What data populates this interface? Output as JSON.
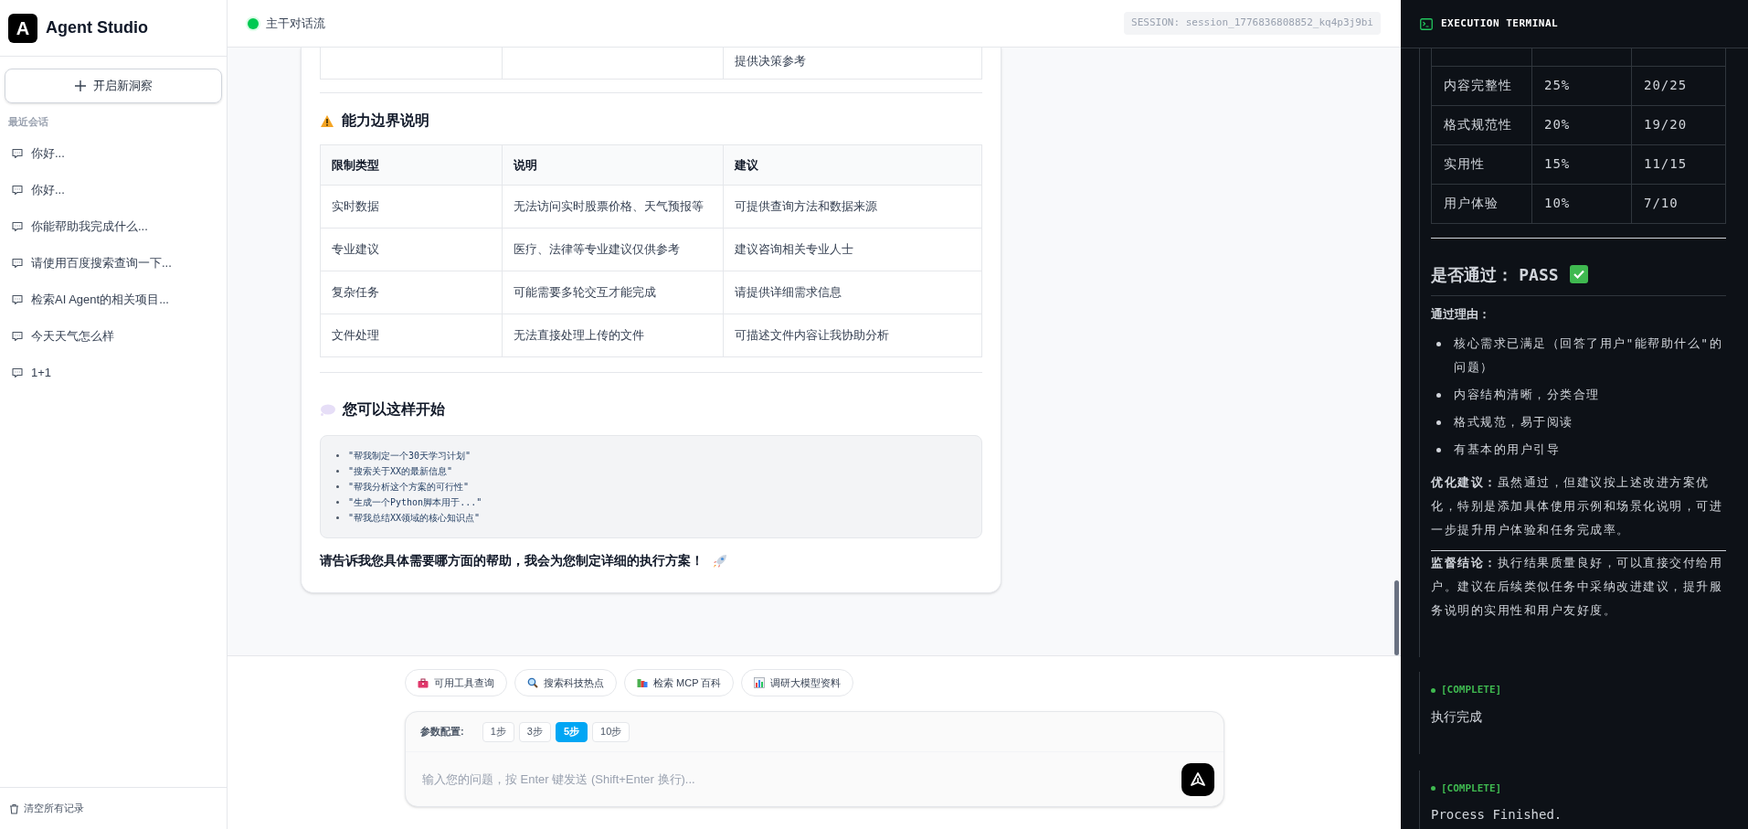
{
  "sidebar": {
    "logo_letter": "A",
    "app_name": "Agent Studio",
    "new_button": "开启新洞察",
    "section_label": "最近会话",
    "conversations": [
      {
        "title": "你好..."
      },
      {
        "title": "你好..."
      },
      {
        "title": "你能帮助我完成什么..."
      },
      {
        "title": "请使用百度搜索查询一下..."
      },
      {
        "title": "检索AI Agent的相关项目..."
      },
      {
        "title": "今天天气怎么样"
      },
      {
        "title": "1+1"
      }
    ],
    "clear_button": "清空所有记录"
  },
  "header": {
    "status": "主干对话流",
    "session": "SESSION: session_1776836808852_kq4p3j9bi"
  },
  "message": {
    "partial_row": {
      "column_3": "提供决策参考"
    },
    "limits": {
      "heading": "能力边界说明",
      "columns": [
        "限制类型",
        "说明",
        "建议"
      ],
      "rows": [
        [
          "实时数据",
          "无法访问实时股票价格、天气预报等",
          "可提供查询方法和数据来源"
        ],
        [
          "专业建议",
          "医疗、法律等专业建议仅供参考",
          "建议咨询相关专业人士"
        ],
        [
          "复杂任务",
          "可能需要多轮交互才能完成",
          "请提供详细需求信息"
        ],
        [
          "文件处理",
          "无法直接处理上传的文件",
          "可描述文件内容让我协助分析"
        ]
      ]
    },
    "start": {
      "heading": "您可以这样开始",
      "examples": [
        "\"帮我制定一个30天学习计划\"",
        "\"搜索关于XX的最新信息\"",
        "\"帮我分析这个方案的可行性\"",
        "\"生成一个Python脚本用于...\"",
        "\"帮我总结XX领域的核心知识点\""
      ]
    },
    "closing": "请告诉我您具体需要哪方面的帮助，我会为您制定详细的执行方案！"
  },
  "composer": {
    "chips": [
      "可用工具查询",
      "搜索科技热点",
      "检索 MCP 百科",
      "调研大模型资料"
    ],
    "params_label": "参数配置:",
    "steps": [
      {
        "label": "1步",
        "selected": false
      },
      {
        "label": "3步",
        "selected": false
      },
      {
        "label": "5步",
        "selected": true
      },
      {
        "label": "10步",
        "selected": false
      }
    ],
    "placeholder": "输入您的问题，按 Enter 键发送 (Shift+Enter 换行)..."
  },
  "terminal": {
    "title": "EXECUTION TERMINAL",
    "score_rows": [
      [
        "内容完整性",
        "25%",
        "20/25"
      ],
      [
        "格式规范性",
        "20%",
        "19/20"
      ],
      [
        "实用性",
        "15%",
        "11/15"
      ],
      [
        "用户体验",
        "10%",
        "7/10"
      ]
    ],
    "verdict_label": "是否通过：",
    "verdict": "PASS",
    "reasons_heading": "通过理由：",
    "reasons": [
      "核心需求已满足（回答了用户\"能帮助什么\"的问题）",
      "内容结构清晰，分类合理",
      "格式规范，易于阅读",
      "有基本的用户引导"
    ],
    "suggestion": "**优化建议：**虽然通过，但建议按上述改进方案优化，特别是添加具体使用示例和场景化说明，可进一步提升用户体验和任务完成率。",
    "conclusion": "**监督结论：**执行结果质量良好，可以直接交付给用户。建议在后续类似任务中采纳改进建议，提升服务说明的实用性和用户友好度。",
    "events": [
      {
        "tag": "[COMPLETE]",
        "text": "执行完成"
      },
      {
        "tag": "[COMPLETE]",
        "text": "Process Finished."
      }
    ]
  }
}
